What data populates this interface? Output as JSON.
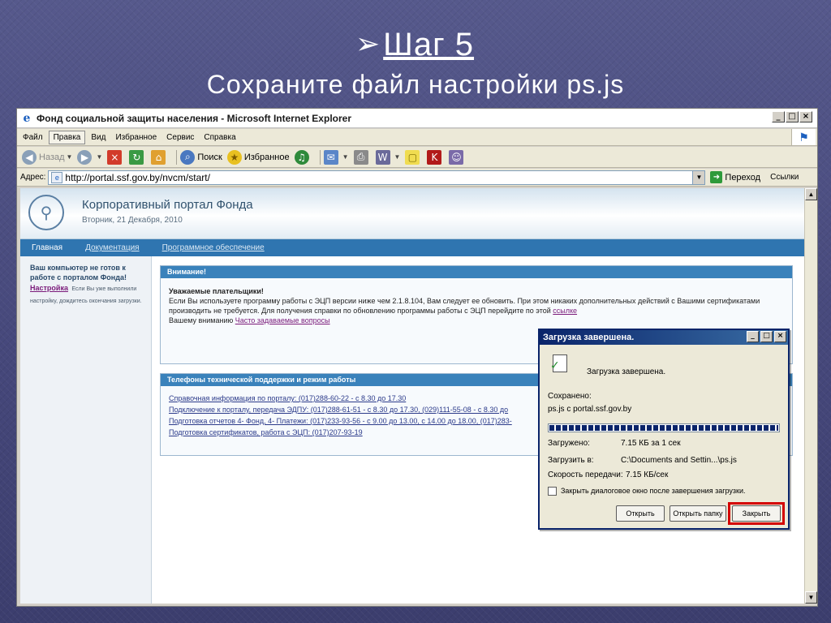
{
  "slide": {
    "step_arrow": "➢",
    "step_title": "Шаг 5",
    "subtitle": "Сохраните файл настройки ps.js"
  },
  "browser": {
    "window_title": "Фонд социальной защиты населения - Microsoft Internet Explorer",
    "menu": [
      "Файл",
      "Правка",
      "Вид",
      "Избранное",
      "Сервис",
      "Справка"
    ],
    "toolbar": {
      "back": "Назад",
      "search": "Поиск",
      "favorites": "Избранное"
    },
    "address_label": "Адрес:",
    "address_url": "http://portal.ssf.gov.by/nvcm/start/",
    "go_label": "Переход",
    "links_label": "Ссылки"
  },
  "portal": {
    "title": "Корпоративный портал Фонда",
    "date": "Вторник, 21 Декабря, 2010",
    "nav": [
      "Главная",
      "Документация",
      "Программное обеспечение"
    ],
    "left_bold": "Ваш компьютер не готов к работе с порталом Фонда!",
    "left_link": "Настройка",
    "left_text": "Если Вы уже выполнили настройку, дождитесь окончания загрузки.",
    "panel1_title": "Внимание!",
    "panel1_greeting": "Уважаемые плательщики!",
    "panel1_text": "Если Вы используете программу работы с ЭЦП версии ниже чем 2.1.8.104, Вам следует ее обновить. При этом никаких дополнительных действий с Вашими сертификатами производить не требуется. Для получения справки по обновлению программы работы с ЭЦП перейдите по этой",
    "panel1_link": "ссылке",
    "panel1_text2": "Вашему вниманию",
    "panel1_link2": "Часто задаваемые вопросы",
    "panel2_title": "Телефоны технической поддержки и режим работы",
    "panel2_rows": [
      "Справочная информация по порталу: (017)288-60-22 - с 8.30 до 17.30",
      "Подключение к порталу, передача ЭДПУ: (017)288-61-51 - с 8.30 до 17.30, (029)111-55-08 - с 8.30 до",
      "Подготовка отчетов 4- Фонд, 4- Платежи: (017)233-93-56 - с 9.00 до 13.00, с 14.00 до 18.00, (017)283-",
      "Подготовка сертификатов, работа с ЭЦП: (017)207-93-19"
    ]
  },
  "dialog": {
    "title": "Загрузка завершена.",
    "message": "Загрузка завершена.",
    "saved_label": "Сохранено:",
    "saved_value": "ps.js с portal.ssf.gov.by",
    "progress": 1.0,
    "downloaded_label": "Загружено:",
    "downloaded_value": "7.15 КБ за 1 сек",
    "dest_label": "Загрузить в:",
    "dest_value": "C:\\Documents and Settin...\\ps.js",
    "speed_label": "Скорость передачи:",
    "speed_value": "7.15 КБ/сек",
    "checkbox_label": "Закрыть диалоговое окно после завершения загрузки.",
    "btn_open": "Открыть",
    "btn_open_folder": "Открыть папку",
    "btn_close": "Закрыть",
    "highlight_color": "#d40000"
  },
  "icons": [
    "ie-logo-icon",
    "back-arrow-icon",
    "forward-arrow-icon",
    "stop-icon",
    "refresh-icon",
    "home-icon",
    "search-icon",
    "favorites-star-icon",
    "media-icon",
    "mail-icon",
    "print-icon",
    "edit-icon",
    "notes-icon",
    "k-icon",
    "messenger-icon",
    "go-arrow-icon",
    "windows-flag-icon",
    "download-complete-icon"
  ]
}
